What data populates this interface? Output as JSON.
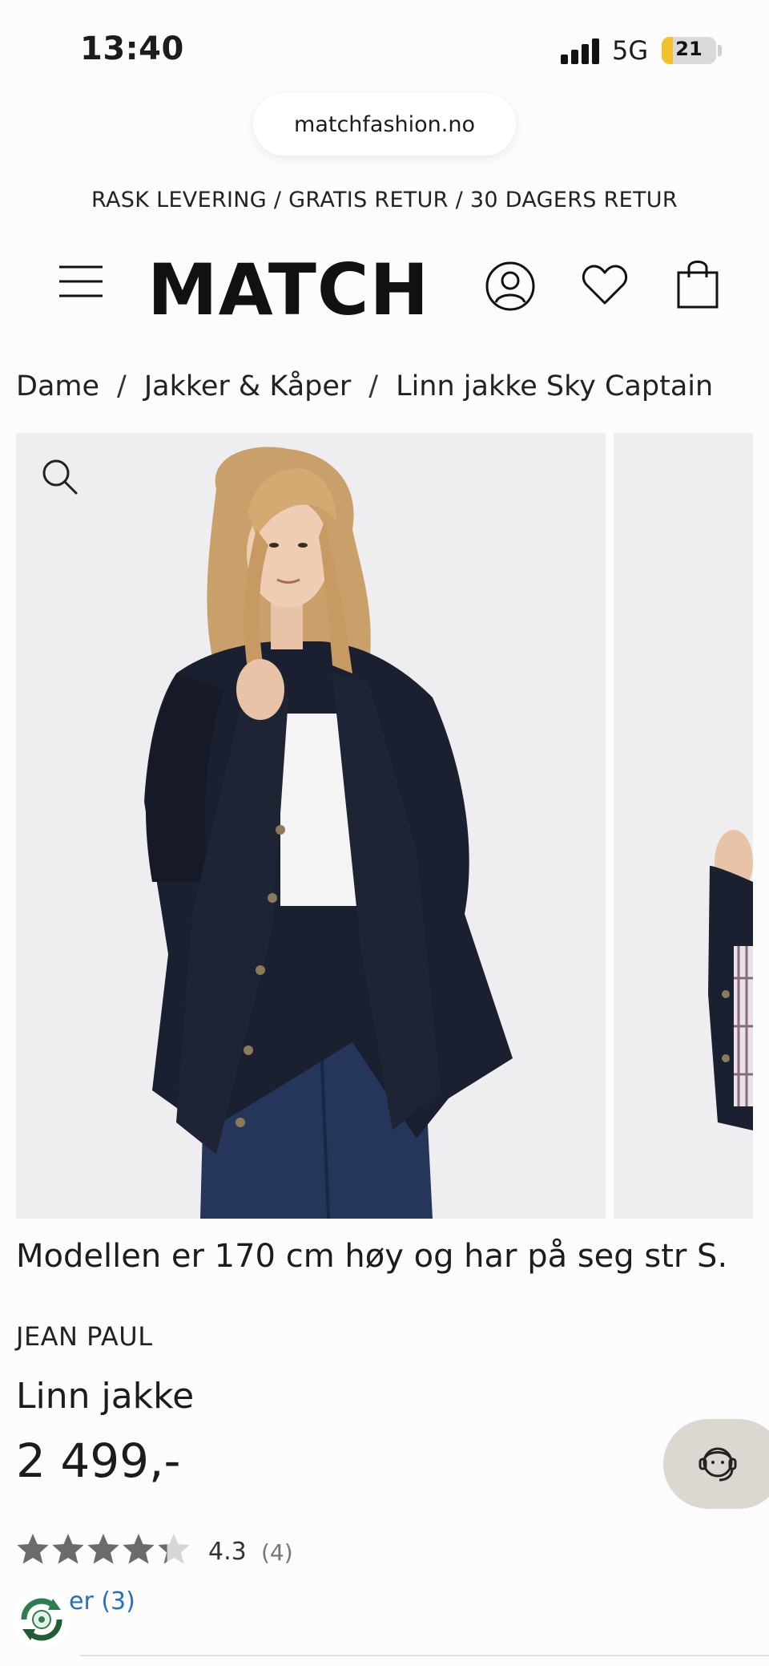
{
  "status_bar": {
    "time": "13:40",
    "network": "5G",
    "battery": "21",
    "battery_level": 0.21
  },
  "browser": {
    "url": "matchfashion.no"
  },
  "promo": {
    "text": "RASK LEVERING / GRATIS RETUR / 30 DAGERS RETUR"
  },
  "header": {
    "logo": "MATCH",
    "icons": [
      "menu-icon",
      "account-icon",
      "wishlist-icon",
      "cart-icon"
    ]
  },
  "breadcrumb": {
    "items": [
      "Dame",
      "Jakker & Kåper",
      "Linn jakke Sky Captain"
    ],
    "separator": "/"
  },
  "product": {
    "model_note": "Modellen er 170 cm høy og har på seg str S.",
    "brand": "JEAN PAUL",
    "title": "Linn jakke",
    "price": "2 499,-",
    "rating": {
      "value": "4.3",
      "count": "(4)",
      "stars": 4.3,
      "max": 5
    },
    "reviews_link": "er (3)"
  },
  "colors": {
    "background": "#fdfcfc",
    "text": "#1c1c1c",
    "link": "#2a6ec1",
    "star": "#6b6b6b",
    "chat_bg": "#ddd7d1",
    "jacket": "#1b2030",
    "jeans": "#25365a"
  }
}
